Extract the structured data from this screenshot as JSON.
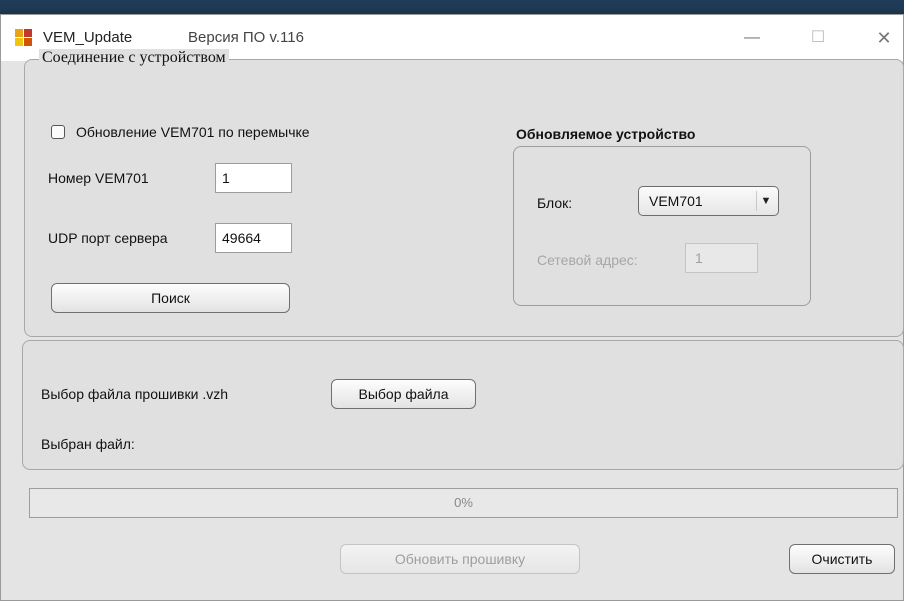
{
  "window": {
    "app_name": "VEM_Update",
    "version": "Версия ПО v.116",
    "minimize_glyph": "—",
    "maximize_glyph": "☐",
    "close_glyph": "✕"
  },
  "connection": {
    "legend": "Соединение с устройством",
    "jumper_update_label": "Обновление VEM701 по перемычке",
    "jumper_update_checked": false,
    "vem_number_label": "Номер VEM701",
    "vem_number_value": "1",
    "udp_port_label": "UDP порт сервера",
    "udp_port_value": "49664",
    "search_button": "Поиск"
  },
  "device": {
    "title": "Обновляемое устройство",
    "block_label": "Блок:",
    "block_value": "VEM701",
    "network_address_label": "Сетевой адрес:",
    "network_address_value": "1"
  },
  "firmware": {
    "select_label": "Выбор файла прошивки .vzh",
    "select_button": "Выбор файла",
    "selected_label": "Выбран файл:"
  },
  "progress": {
    "percent": 0,
    "text": "0%"
  },
  "actions": {
    "update_button": "Обновить прошивку",
    "clear_button": "Очистить"
  },
  "colors": {
    "app_icon": [
      "#e8a317",
      "#c0392b",
      "#f1c40f",
      "#d35400"
    ]
  }
}
